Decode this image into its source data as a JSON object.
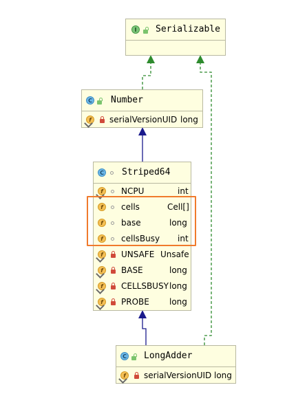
{
  "classes": {
    "serializable": {
      "name": "Serializable",
      "kind": "interface",
      "badge": "I"
    },
    "number": {
      "name": "Number",
      "kind": "class",
      "badge": "C",
      "fields": [
        {
          "name": "serialVersionUID",
          "type": "long",
          "badge": "f"
        }
      ]
    },
    "striped64": {
      "name": "Striped64",
      "kind": "class",
      "badge": "C",
      "fields": [
        {
          "name": "NCPU",
          "type": "int",
          "badge": "f"
        },
        {
          "name": "cells",
          "type": "Cell[]",
          "badge": "f"
        },
        {
          "name": "base",
          "type": "long",
          "badge": "f"
        },
        {
          "name": "cellsBusy",
          "type": "int",
          "badge": "f"
        },
        {
          "name": "UNSAFE",
          "type": "Unsafe",
          "badge": "f"
        },
        {
          "name": "BASE",
          "type": "long",
          "badge": "f"
        },
        {
          "name": "CELLSBUSY",
          "type": "long",
          "badge": "f"
        },
        {
          "name": "PROBE",
          "type": "long",
          "badge": "f"
        }
      ]
    },
    "longadder": {
      "name": "LongAdder",
      "kind": "class",
      "badge": "C",
      "fields": [
        {
          "name": "serialVersionUID",
          "type": "long",
          "badge": "f"
        }
      ]
    }
  },
  "relations": [
    {
      "from": "Number",
      "to": "Serializable",
      "type": "implements"
    },
    {
      "from": "LongAdder",
      "to": "Serializable",
      "type": "implements"
    },
    {
      "from": "Striped64",
      "to": "Number",
      "type": "extends"
    },
    {
      "from": "LongAdder",
      "to": "Striped64",
      "type": "extends"
    }
  ],
  "colors": {
    "box_fill": "#fefee0",
    "box_border": "#b8b8a0",
    "implements_edge": "#2e8b2e",
    "extends_edge": "#1a1a8c",
    "highlight": "#f07a2c"
  }
}
